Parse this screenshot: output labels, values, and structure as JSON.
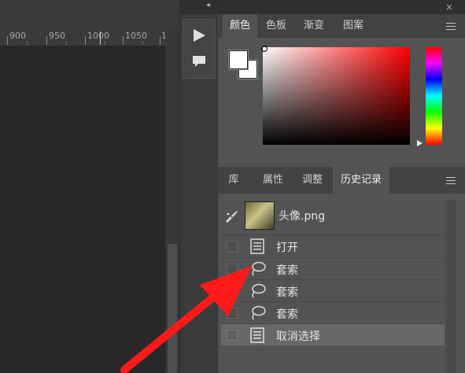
{
  "ruler": {
    "ticks": [
      "900",
      "950",
      "1000",
      "1050",
      "1"
    ]
  },
  "mid_panel": {
    "collapse_glyph": "«",
    "icons": [
      "play-icon",
      "comment-icon"
    ]
  },
  "right_header": {
    "collapse_glyph": "«",
    "close_glyph": "×"
  },
  "color_panel": {
    "tabs": [
      {
        "label": "颜色",
        "active": true
      },
      {
        "label": "色板",
        "active": false
      },
      {
        "label": "渐变",
        "active": false
      },
      {
        "label": "图案",
        "active": false
      }
    ],
    "foreground_color": "#ffffff",
    "background_color": "#ffffff",
    "hue_color": "#ff0000"
  },
  "history_panel": {
    "tabs": [
      {
        "label": "库",
        "active": false
      },
      {
        "label": "属性",
        "active": false
      },
      {
        "label": "调整",
        "active": false
      },
      {
        "label": "历史记录",
        "active": true
      }
    ],
    "snapshot": {
      "label": "头像.png"
    },
    "rows": [
      {
        "label": "打开",
        "icon": "document-icon",
        "selected": false
      },
      {
        "label": "套索",
        "icon": "lasso-icon",
        "selected": false
      },
      {
        "label": "套索",
        "icon": "lasso-icon",
        "selected": false
      },
      {
        "label": "套索",
        "icon": "lasso-icon",
        "selected": false
      },
      {
        "label": "取消选择",
        "icon": "document-icon",
        "selected": true
      }
    ]
  },
  "annotation": {
    "color": "#ff1a1a"
  }
}
